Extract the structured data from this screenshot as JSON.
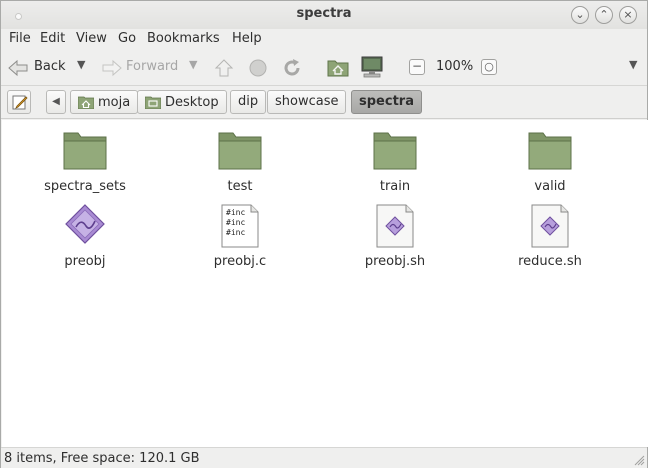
{
  "window": {
    "title": "spectra"
  },
  "menu": [
    "File",
    "Edit",
    "View",
    "Go",
    "Bookmarks",
    "Help"
  ],
  "toolbar": {
    "back_label": "Back",
    "forward_label": "Forward",
    "zoom": "100%"
  },
  "pathbar": {
    "crumbs": [
      {
        "label": "moja",
        "icon": "home-icon"
      },
      {
        "label": "Desktop",
        "icon": "desktop-icon"
      },
      {
        "label": "dip"
      },
      {
        "label": "showcase"
      },
      {
        "label": "spectra"
      }
    ]
  },
  "files": [
    {
      "name": "spectra_sets",
      "icon": "folder-icon"
    },
    {
      "name": "test",
      "icon": "folder-icon"
    },
    {
      "name": "train",
      "icon": "folder-icon"
    },
    {
      "name": "valid",
      "icon": "folder-icon"
    },
    {
      "name": "preobj",
      "icon": "executable-icon"
    },
    {
      "name": "preobj.c",
      "icon": "c-source-icon",
      "preview": [
        "#inc",
        "#inc",
        "#inc"
      ]
    },
    {
      "name": "preobj.sh",
      "icon": "script-icon"
    },
    {
      "name": "reduce.sh",
      "icon": "script-icon"
    }
  ],
  "status": {
    "text": "8 items, Free space: 120.1 GB"
  },
  "colors": {
    "folder": "#8ea476",
    "folder_dark": "#6f8659",
    "accent_purple": "#9b7dc8"
  }
}
